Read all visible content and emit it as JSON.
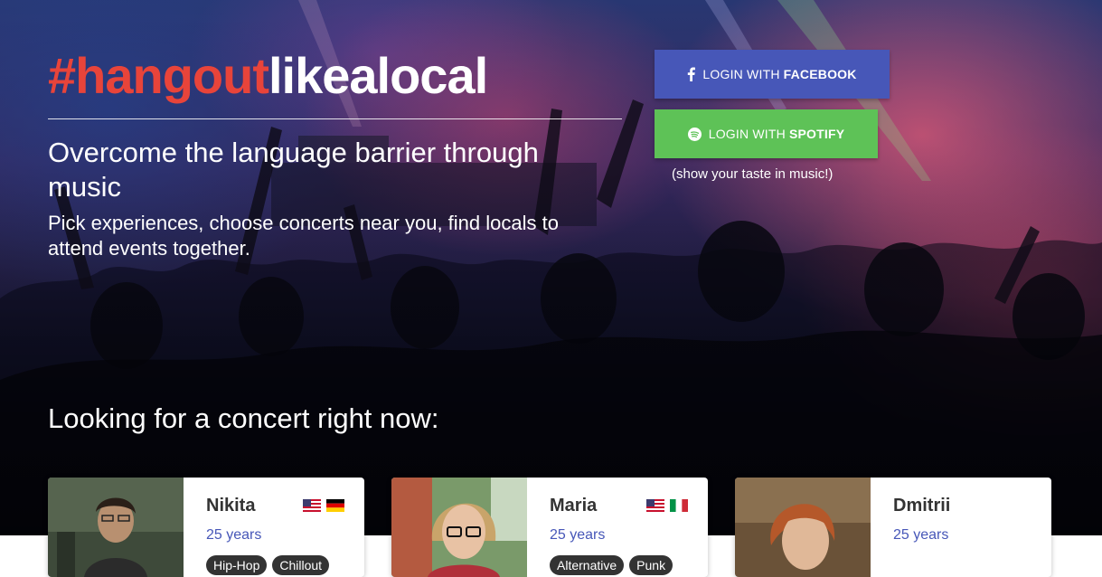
{
  "hero": {
    "headline_accent": "#hangout",
    "headline_plain": "likealocal",
    "subtitle": "Overcome the language barrier through music",
    "description": "Pick experiences, choose concerts near you, find locals to attend events together."
  },
  "auth": {
    "facebook": {
      "prefix": "LOGIN WITH",
      "brand": "FACEBOOK",
      "icon": "facebook-icon"
    },
    "spotify": {
      "prefix": "LOGIN WITH",
      "brand": "SPOTIFY",
      "icon": "spotify-icon"
    },
    "note": "(show your taste in music!)"
  },
  "section": {
    "title": "Looking for a concert right now:"
  },
  "people": [
    {
      "name": "Nikita",
      "age": "25 years",
      "flags": [
        "us-flag-icon",
        "de-flag-icon"
      ],
      "tags": [
        "Hip-Hop",
        "Chillout"
      ]
    },
    {
      "name": "Maria",
      "age": "25 years",
      "flags": [
        "us-flag-icon",
        "it-flag-icon"
      ],
      "tags": [
        "Alternative",
        "Punk"
      ]
    },
    {
      "name": "Dmitrii",
      "age": "25 years",
      "flags": [],
      "tags": []
    }
  ],
  "colors": {
    "accent": "#e8443a",
    "facebook": "#4757b8",
    "spotify": "#5ec257",
    "age_text": "#4757b8",
    "tag_bg": "#333333"
  }
}
